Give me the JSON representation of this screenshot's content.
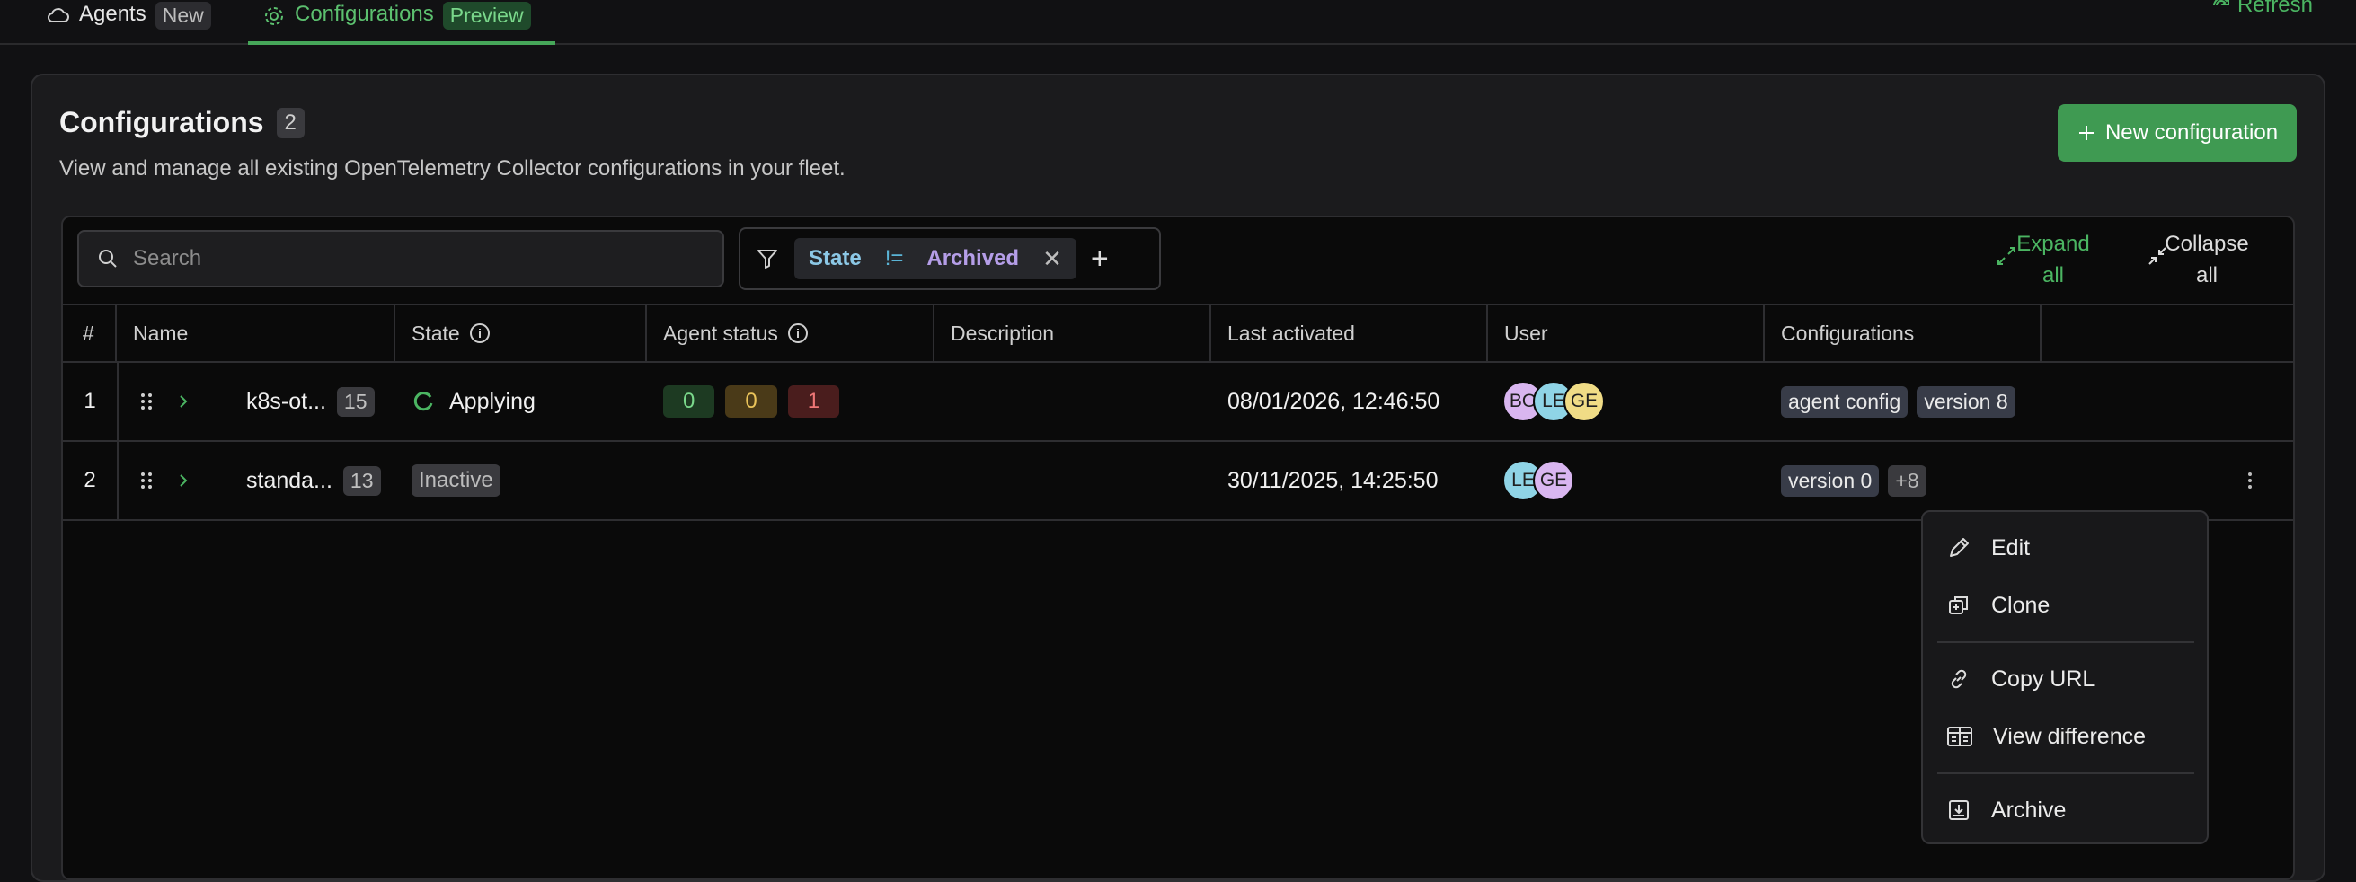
{
  "tabs": [
    {
      "label": "Agents",
      "badge": "New",
      "icon": "cloud-icon"
    },
    {
      "label": "Configurations",
      "badge": "Preview",
      "icon": "gear-icon"
    }
  ],
  "refresh_label": "Refresh",
  "page": {
    "title": "Configurations",
    "count": "2",
    "subtitle": "View and manage all existing OpenTelemetry Collector configurations in your fleet.",
    "new_button": "New configuration"
  },
  "search": {
    "placeholder": "Search"
  },
  "filter": {
    "field": "State",
    "operator": "!=",
    "value": "Archived"
  },
  "actions": {
    "expand": [
      "Expand",
      "all"
    ],
    "collapse": [
      "Collapse",
      "all"
    ]
  },
  "columns": [
    "#",
    "Name",
    "State",
    "Agent status",
    "Description",
    "Last activated",
    "User",
    "Configurations"
  ],
  "rows": [
    {
      "num": "1",
      "name": "k8s-ot...",
      "count": "15",
      "state": "Applying",
      "agents": [
        "0",
        "0",
        "1"
      ],
      "description": "",
      "last_activated": "08/01/2026, 12:46:50",
      "users": [
        "BO",
        "LE",
        "GE"
      ],
      "configs": [
        "agent config",
        "version 8"
      ]
    },
    {
      "num": "2",
      "name": "standa...",
      "count": "13",
      "state": "Inactive",
      "agents": [],
      "description": "",
      "last_activated": "30/11/2025, 14:25:50",
      "users": [
        "LE",
        "GE"
      ],
      "configs": [
        "version 0"
      ],
      "more": "+8"
    }
  ],
  "menu": [
    "Edit",
    "Clone",
    "Copy URL",
    "View difference",
    "Archive"
  ],
  "colors": {
    "accent": "#3f9a52",
    "avatar_bo": "#d9b6f0",
    "avatar_le": "#8fd4e6",
    "avatar_ge": "#f0dc86"
  }
}
